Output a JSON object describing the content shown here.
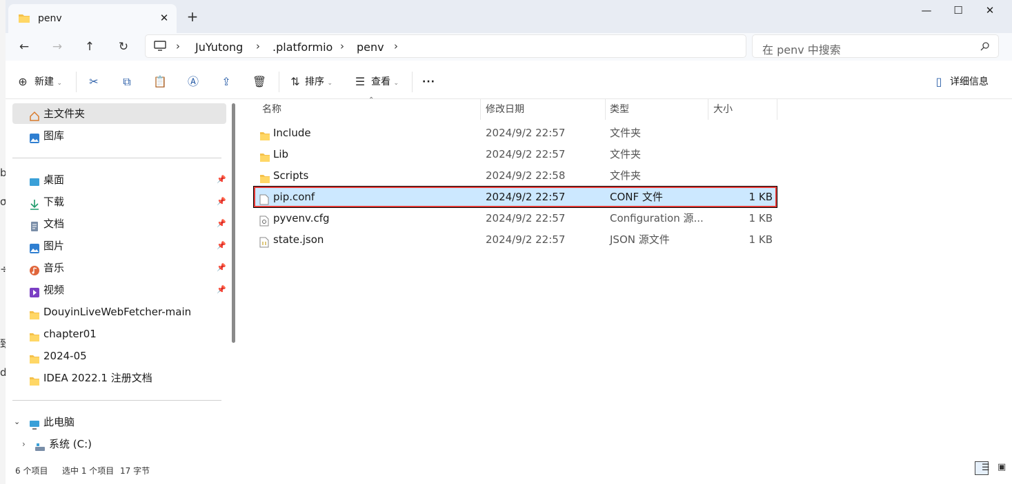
{
  "window": {
    "tab_title": "penv",
    "tab_close": "✕",
    "new_tab": "+",
    "minimize": "—",
    "maximize": "☐",
    "close": "✕"
  },
  "address": {
    "crumbs": [
      "JuYutong",
      ".platformio",
      "penv"
    ],
    "search_placeholder": "在 penv 中搜索"
  },
  "toolbar": {
    "new_label": "新建",
    "sort_label": "排序",
    "view_label": "查看",
    "more": "···",
    "details_label": "详细信息"
  },
  "sidebar": {
    "home": "主文件夹",
    "gallery": "图库",
    "quick": [
      {
        "label": "桌面",
        "icon": "desktop-icon",
        "pinned": true
      },
      {
        "label": "下载",
        "icon": "download-icon",
        "pinned": true
      },
      {
        "label": "文档",
        "icon": "document-icon",
        "pinned": true
      },
      {
        "label": "图片",
        "icon": "pictures-icon",
        "pinned": true
      },
      {
        "label": "音乐",
        "icon": "music-icon",
        "pinned": true
      },
      {
        "label": "视频",
        "icon": "video-icon",
        "pinned": true
      },
      {
        "label": "DouyinLiveWebFetcher-main",
        "icon": "folder-icon",
        "pinned": false
      },
      {
        "label": "chapter01",
        "icon": "folder-icon",
        "pinned": false
      },
      {
        "label": "2024-05",
        "icon": "folder-icon",
        "pinned": false
      },
      {
        "label": "IDEA 2022.1 注册文档",
        "icon": "folder-icon",
        "pinned": false
      }
    ],
    "this_pc": "此电脑",
    "drive_c": "系统 (C:)"
  },
  "columns": {
    "name": "名称",
    "modified": "修改日期",
    "type": "类型",
    "size": "大小"
  },
  "files": [
    {
      "name": "Include",
      "modified": "2024/9/2 22:57",
      "type": "文件夹",
      "size": "",
      "icon": "folder-icon"
    },
    {
      "name": "Lib",
      "modified": "2024/9/2 22:57",
      "type": "文件夹",
      "size": "",
      "icon": "folder-icon"
    },
    {
      "name": "Scripts",
      "modified": "2024/9/2 22:58",
      "type": "文件夹",
      "size": "",
      "icon": "folder-icon"
    },
    {
      "name": "pip.conf",
      "modified": "2024/9/2 22:57",
      "type": "CONF 文件",
      "size": "1 KB",
      "icon": "file-icon",
      "selected": true
    },
    {
      "name": "pyvenv.cfg",
      "modified": "2024/9/2 22:57",
      "type": "Configuration 源...",
      "size": "1 KB",
      "icon": "config-file-icon"
    },
    {
      "name": "state.json",
      "modified": "2024/9/2 22:57",
      "type": "JSON 源文件",
      "size": "1 KB",
      "icon": "json-file-icon"
    }
  ],
  "status": {
    "count": "6 个项目",
    "selected": "选中 1 个项目",
    "bytes": "17 字节"
  },
  "colors": {
    "accent": "#0067c0",
    "selection": "#cce8ff",
    "highlight_box": "#e53935",
    "folder": "#f5c14b"
  }
}
